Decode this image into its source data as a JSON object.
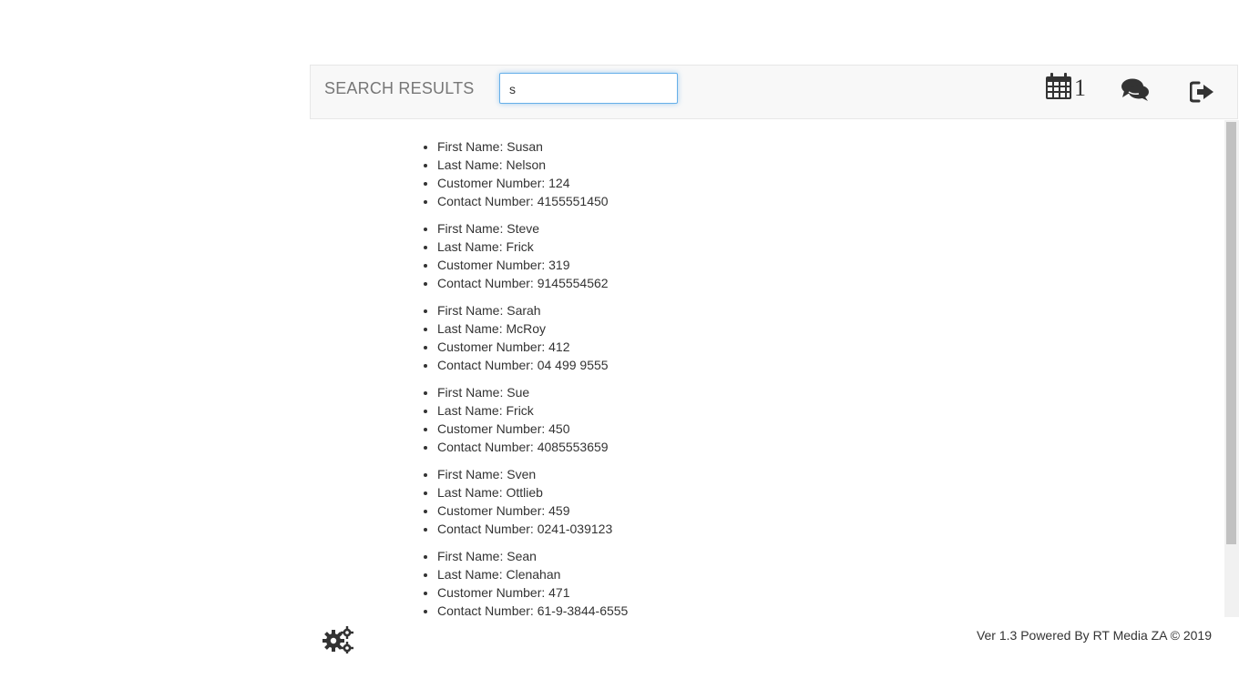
{
  "header": {
    "title": "SEARCH RESULTS",
    "search_value": "s",
    "calendar_count": "1",
    "icons": {
      "calendar": "calendar-icon",
      "chat": "chat-icon",
      "logout": "logout-icon"
    }
  },
  "results": [
    {
      "first_label": "First Name: Susan",
      "last_label": "Last Name: Nelson",
      "customer_label": "Customer Number: 124",
      "contact_label": "Contact Number: 4155551450"
    },
    {
      "first_label": "First Name: Steve",
      "last_label": "Last Name: Frick",
      "customer_label": "Customer Number: 319",
      "contact_label": "Contact Number: 9145554562"
    },
    {
      "first_label": "First Name: Sarah",
      "last_label": "Last Name: McRoy",
      "customer_label": "Customer Number: 412",
      "contact_label": "Contact Number: 04 499 9555"
    },
    {
      "first_label": "First Name: Sue",
      "last_label": "Last Name: Frick",
      "customer_label": "Customer Number: 450",
      "contact_label": "Contact Number: 4085553659"
    },
    {
      "first_label": "First Name: Sven",
      "last_label": "Last Name: Ottlieb",
      "customer_label": "Customer Number: 459",
      "contact_label": "Contact Number: 0241-039123"
    },
    {
      "first_label": "First Name: Sean",
      "last_label": "Last Name: Clenahan",
      "customer_label": "Customer Number: 471",
      "contact_label": "Contact Number: 61-9-3844-6555"
    }
  ],
  "footer": {
    "settings_icon": "gears-icon",
    "version_text": "Ver 1.3 Powered By RT Media ZA © 2019"
  },
  "colors": {
    "navbar_bg": "#f8f8f8",
    "input_focus_border": "#66afe9",
    "text": "#333333",
    "brand_text": "#777777"
  }
}
